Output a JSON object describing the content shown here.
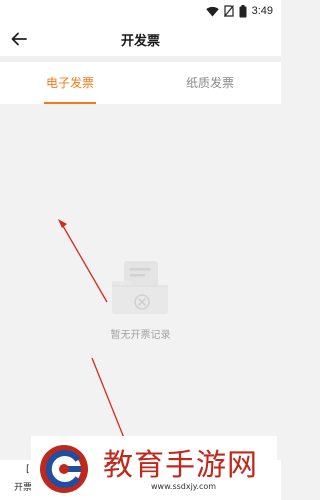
{
  "status_bar": {
    "time": "3:49",
    "icons": [
      "wifi-icon",
      "sim-off-icon",
      "battery-icon"
    ]
  },
  "header": {
    "title": "开发票",
    "back_icon": "back-arrow-icon"
  },
  "tabs": [
    {
      "label": "电子发票",
      "active": true
    },
    {
      "label": "纸质发票",
      "active": false
    }
  ],
  "empty_state": {
    "icon": "empty-invoice-folder-icon",
    "message": "暂无开票记录"
  },
  "bottom_bar": {
    "partial_bracket": "[",
    "partial_label": "开票"
  },
  "watermark": {
    "title": "教育手游网",
    "url": "www.ssdxjy.com"
  },
  "colors": {
    "accent": "#f07c19",
    "annotation": "#d42a1f",
    "background": "#f2f2f2"
  }
}
